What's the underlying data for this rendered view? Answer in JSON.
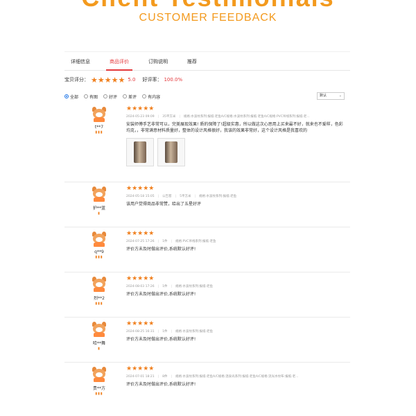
{
  "hero": {
    "title": "Client Testimonials",
    "subtitle": "CUSTOMER FEEDBACK"
  },
  "tabs": [
    {
      "label": "详细信息",
      "active": false
    },
    {
      "label": "商品评价",
      "active": true
    },
    {
      "label": "订购说明",
      "active": false
    },
    {
      "label": "推荐",
      "active": false
    }
  ],
  "summary": {
    "label": "宝贝评分：",
    "stars": "★★★★★",
    "score": "5.0",
    "good_label": "好评率：",
    "good_rate": "100.0%"
  },
  "filters": [
    {
      "label": "全部",
      "checked": true
    },
    {
      "label": "有图",
      "checked": false
    },
    {
      "label": "好评",
      "checked": false
    },
    {
      "label": "差评",
      "checked": false
    },
    {
      "label": "有内容",
      "checked": false
    }
  ],
  "sort": {
    "value": "默认",
    "icon": "chevron-down-icon"
  },
  "accent": {
    "orange": "#f39a1e",
    "red": "#e4393c",
    "star": "#f0801f"
  },
  "reviews": [
    {
      "user": "t**7",
      "badge": "▮▮▮",
      "stars": "★★★★★",
      "date": "2024-05-23 09:09",
      "qty": "35平方米",
      "spec": "规格:水波纹系列:报纸:老鱼A/C规格:水波纹系列:报纸:老鱼A/C规格:PVC吊线系列:报纸:老...",
      "text": "安装师傅手艺非常可以，完美展现效果! 质的保障了!超级实惠，所以做这次心思用上买来最不好，就来也不爱样，色彩均克，，非常满意材料质量好，整体的设计风格很好，我该的效果非常好，这个设计风格是我喜欢的",
      "pictures": 2
    },
    {
      "user": "护**蓝",
      "badge": "▮",
      "stars": "★★★★★",
      "date": "2024-05-18 15:05",
      "qty": "5平方米",
      "extra": "公告客",
      "spec": "规格:水波纹系列:报纸:老鱼",
      "text": "该用户觉得商品非常赞，给出了五星好评"
    },
    {
      "user": "q**9",
      "badge": "▮▮▮",
      "stars": "★★★★★",
      "date": "2024-07-25 17:26",
      "qty": "1件",
      "spec": "规格:PVC吊线系列:报纸:老鱼",
      "text": "评价方未及时做出评价,系统默认好评!"
    },
    {
      "user": "烈**2",
      "badge": "▮▮▮",
      "stars": "★★★★★",
      "date": "2024-08-03 17:26",
      "qty": "1件",
      "spec": "规格:水波纹系列:报纸:老鱼",
      "text": "评价方未及时做出评价,系统默认好评!"
    },
    {
      "user": "哈**舞",
      "badge": "▮",
      "stars": "★★★★★",
      "date": "2024-08-25 16:31",
      "qty": "1件",
      "spec": "规格:水波纹系列:报纸:老鱼",
      "text": "评价方未及时做出评价,系统默认好评!"
    },
    {
      "user": "贵**方",
      "badge": "▮▮▮",
      "stars": "★★★★★",
      "date": "2024-07-01 18:21",
      "qty": "8件",
      "spec": "规格:水波纹系列:报纸:老鱼A/C规格:温泉光系列:报纸:老鱼A/C规格:流光水纹布:报纸:老...",
      "text": "评价方未及时做出评价,系统默认好评!"
    }
  ]
}
